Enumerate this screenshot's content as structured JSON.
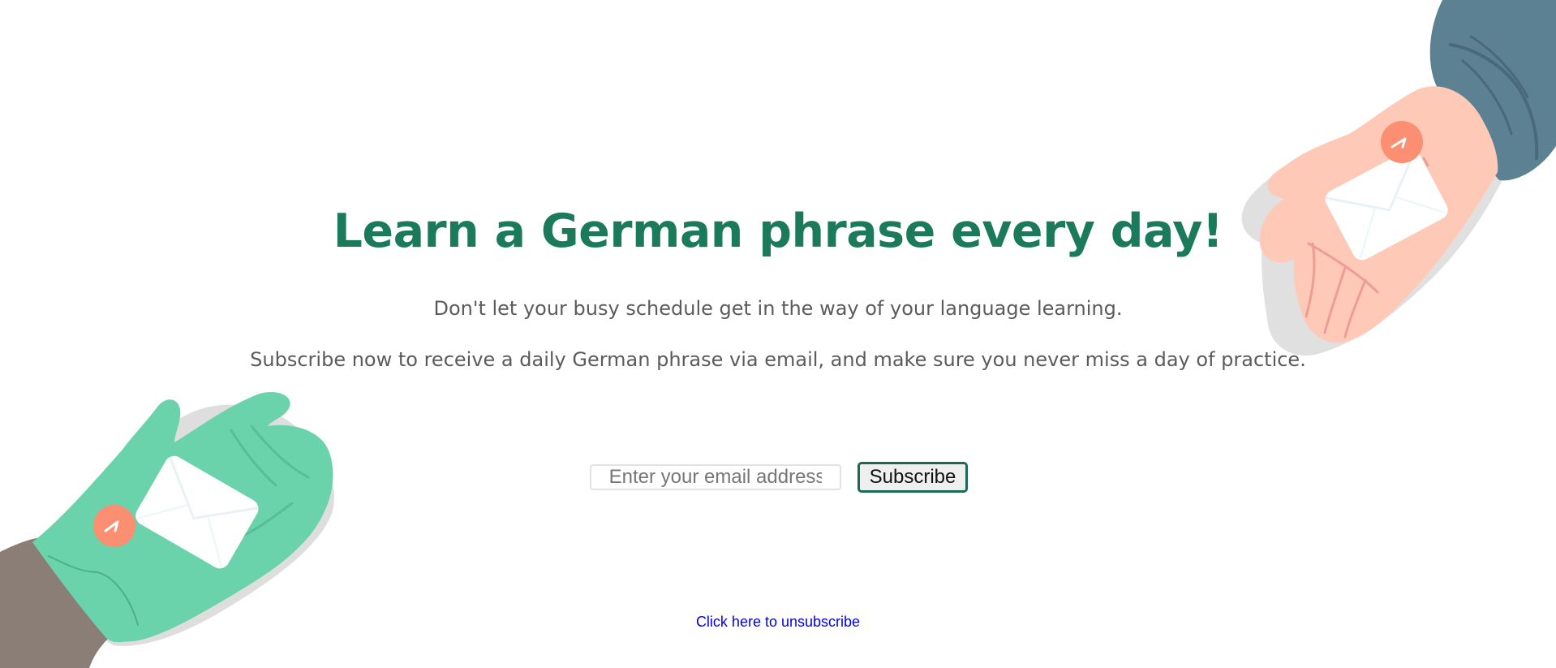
{
  "hero": {
    "title": "Learn a German phrase every day!",
    "paragraph_1": "Don't let your busy schedule get in the way of your language learning.",
    "paragraph_2": "Subscribe now to receive a daily German phrase via email, and make sure you never miss a day of practice."
  },
  "form": {
    "email_placeholder": "Enter your email address",
    "email_value": "",
    "subscribe_label": "Subscribe"
  },
  "footer": {
    "unsubscribe_label": "Click here to unsubscribe"
  },
  "colors": {
    "title": "#1b7a5a",
    "text": "#5b5b5b",
    "link": "#0000ee",
    "button_border": "#1b6a55",
    "glove_green": "#6ad3ac",
    "hand_peach": "#ffc9b8",
    "sleeve_blue": "#5b8193",
    "sleeve_taupe": "#8a7e76",
    "stamp_orange": "#fc8e72"
  },
  "illustrations": {
    "top_right": "hand-holding-envelope-icon",
    "bottom_left": "gloved-hand-holding-envelope-icon"
  }
}
